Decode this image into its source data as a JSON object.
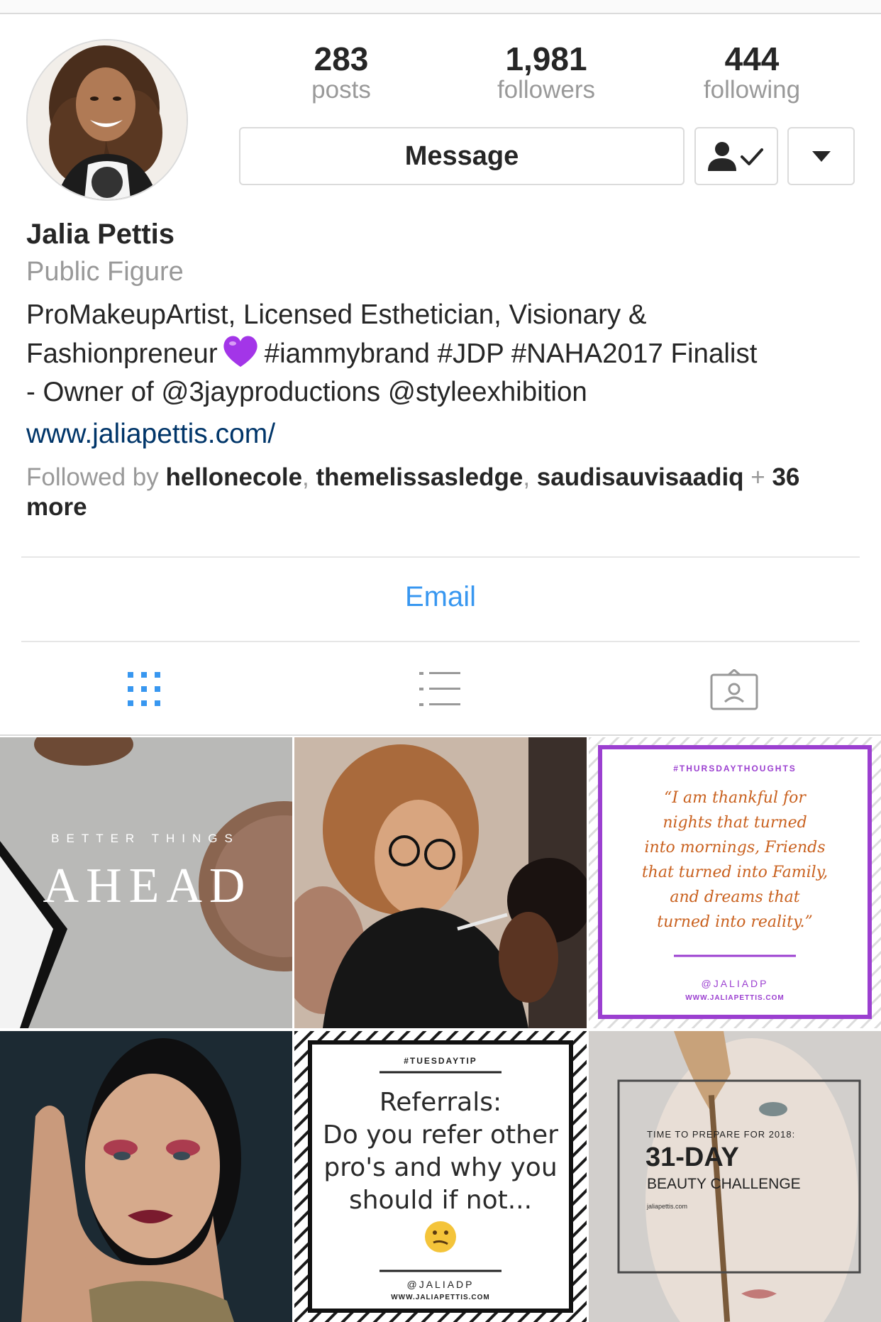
{
  "profile": {
    "stats": [
      {
        "count": "283",
        "label": "posts"
      },
      {
        "count": "1,981",
        "label": "followers"
      },
      {
        "count": "444",
        "label": "following"
      }
    ],
    "message_label": "Message",
    "name": "Jalia Pettis",
    "category": "Public Figure",
    "bio_line1": "ProMakeupArtist, Licensed Esthetician, Visionary &",
    "bio_line2a": "Fashionpreneur",
    "bio_line2b": "#iammybrand #JDP #NAHA2017 Finalist",
    "bio_line3": "- Owner of @3jayproductions @styleexhibition",
    "website": "www.jaliapettis.com/",
    "followed_by": {
      "prefix": "Followed by ",
      "users": [
        "hellonecole",
        "themelissasledge",
        "saudisauvisaadiq"
      ],
      "plus": " + ",
      "more": "36 more"
    },
    "email_label": "Email"
  },
  "icons": {
    "following": "person-check-icon",
    "more": "caret-down-icon",
    "heart": "purple-heart-emoji",
    "grid": "grid-icon",
    "list": "list-icon",
    "tagged": "tagged-icon"
  },
  "colors": {
    "link_blue": "#3897f0",
    "website": "#003569",
    "secondary_text": "#999999",
    "purple_frame": "#9b3fd0"
  },
  "posts": [
    {
      "text1": "BETTER THINGS",
      "text2": "AHEAD"
    },
    {},
    {
      "tag": "#THURSDAYTHOUGHTS",
      "quote": [
        "“I am thankful for",
        "nights that turned",
        "into mornings, Friends",
        "that turned into Family,",
        "and dreams that",
        "turned into reality.”"
      ],
      "handle": "@JALIADP",
      "site": "WWW.JALIAPETTIS.COM"
    },
    {},
    {
      "tag": "#TUESDAYTIP",
      "lines": [
        "Referrals:",
        "Do you refer other",
        "pro's and why you",
        "should if not..."
      ],
      "handle": "@JALIADP",
      "site": "WWW.JALIAPETTIS.COM"
    },
    {
      "text1": "TIME TO PREPARE FOR 2018:",
      "text2": "31-DAY",
      "text3": "BEAUTY CHALLENGE",
      "text4": "jaliapettis.com"
    }
  ]
}
